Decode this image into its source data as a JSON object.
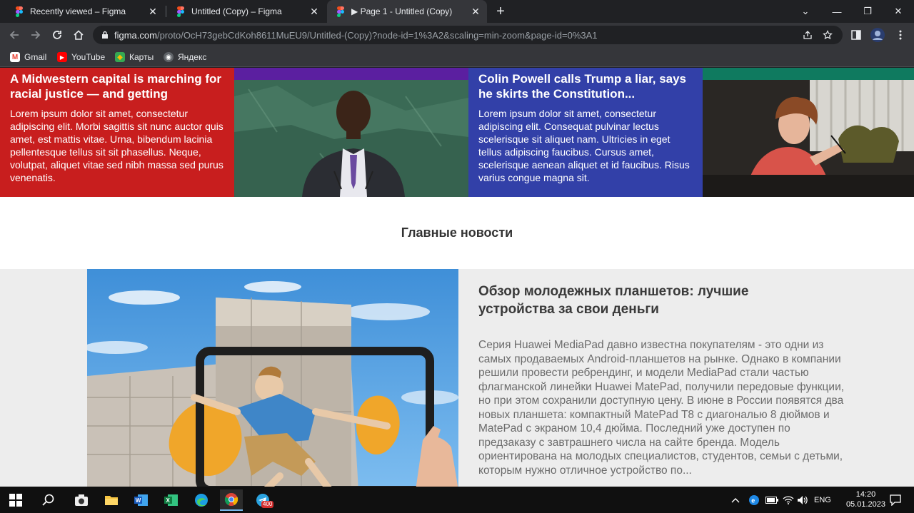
{
  "tabs": [
    {
      "title": "Recently viewed – Figma",
      "close": "✕"
    },
    {
      "title": "Untitled (Copy) – Figma",
      "close": "✕"
    },
    {
      "title": "▶ Page 1 - Untitled (Copy)",
      "close": "✕"
    }
  ],
  "newtab": "+",
  "window_controls": {
    "minimize": "—",
    "restore": "❐",
    "close": "✕",
    "tabsearch": "⌄"
  },
  "address": {
    "host": "figma.com",
    "path": "/proto/OcH73gebCdKoh8611MuEU9/Untitled-(Copy)?node-id=1%3A2&scaling=min-zoom&page-id=0%3A1"
  },
  "bookmarks": [
    {
      "label": "Gmail",
      "icon": "gmail-icon"
    },
    {
      "label": "YouTube",
      "icon": "youtube-icon"
    },
    {
      "label": "Карты",
      "icon": "maps-icon"
    },
    {
      "label": "Яндекс",
      "icon": "yandex-icon"
    }
  ],
  "strip": {
    "left": {
      "headline": "A Midwestern capital is marching for racial justice — and getting",
      "body": "Lorem ipsum dolor sit amet, consectetur adipiscing elit. Morbi sagittis sit nunc auctor quis amet, est mattis vitae. Urna, bibendum lacinia pellentesque tellus sit sit phasellus. Neque, volutpat, aliquet vitae sed nibh massa sed purus venenatis."
    },
    "right": {
      "headline": "Colin Powell calls Trump a liar, says he skirts the Constitution...",
      "body": "Lorem ipsum dolor sit amet, consectetur adipiscing elit. Consequat pulvinar lectus scelerisque sit aliquet nam. Ultricies in eget tellus adipiscing faucibus. Cursus amet, scelerisque aenean aliquet et id faucibus. Risus varius congue magna sit."
    }
  },
  "section_title": "Главные новости",
  "feature": {
    "title": "Обзор молодежных планшетов: лучшие устройства за свои деньги",
    "text": "Серия Huawei MediaPad давно известна покупателям - это одни из самых продаваемых Android-планшетов на рынке. Однако в компании решили провести ребрендинг, и модели MediaPad стали частью флагманской линейки Huawei MatePad, получили передовые функции, но при этом сохранили доступную цену.  В июне в России появятся два новых планшета: компактный MatePad T8 с диагональю 8 дюймов и MatePad с экраном 10,4 дюйма. Последний уже доступен по предзаказу с завтрашнего числа на сайте бренда. Модель ориентирована на молодых специалистов, студентов, семьи с детьми, которым нужно отличное устройство по..."
  },
  "taskbar": {
    "lang": "ENG",
    "time": "14:20",
    "date": "05.01.2023",
    "ghost_date": "05.01.2023",
    "badge": "400"
  },
  "colors": {
    "red": "#c81e1e",
    "blue": "#3240a8",
    "accent_purple": "#5b1fa0",
    "accent_teal": "#0f7a5f"
  }
}
